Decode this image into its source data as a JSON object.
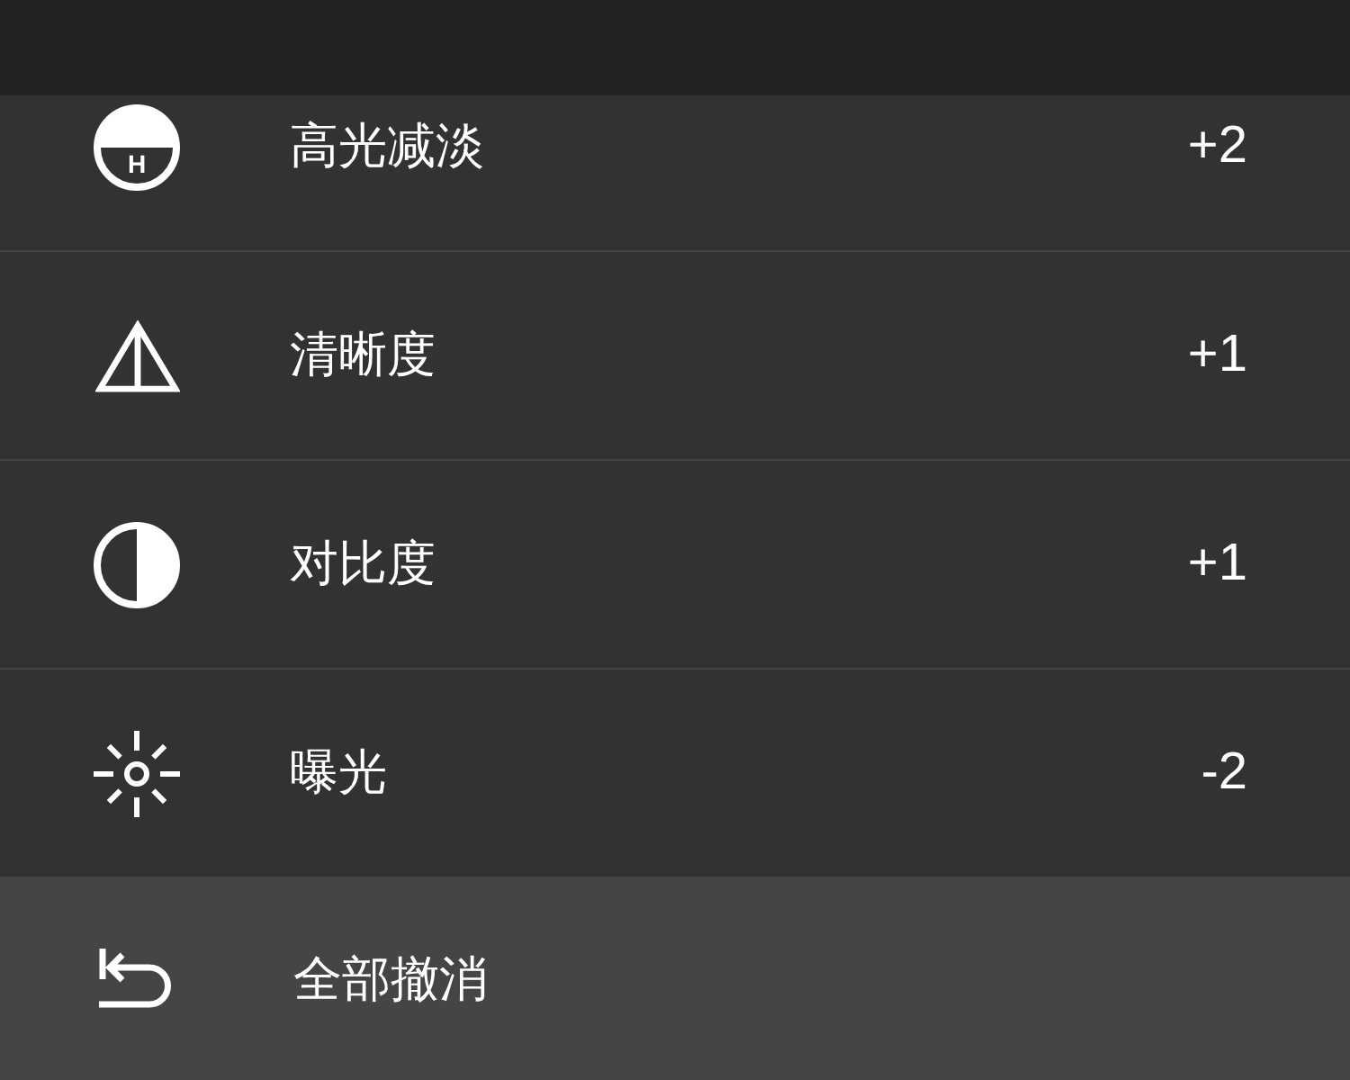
{
  "adjustments": [
    {
      "kind": "highlights",
      "icon_text": "H",
      "label": "高光减淡",
      "value": "+2"
    },
    {
      "kind": "clarity",
      "label": "清晰度",
      "value": "+1"
    },
    {
      "kind": "contrast",
      "label": "对比度",
      "value": "+1"
    },
    {
      "kind": "exposure",
      "label": "曝光",
      "value": "-2"
    }
  ],
  "reset_button": {
    "label": "全部撤消"
  }
}
